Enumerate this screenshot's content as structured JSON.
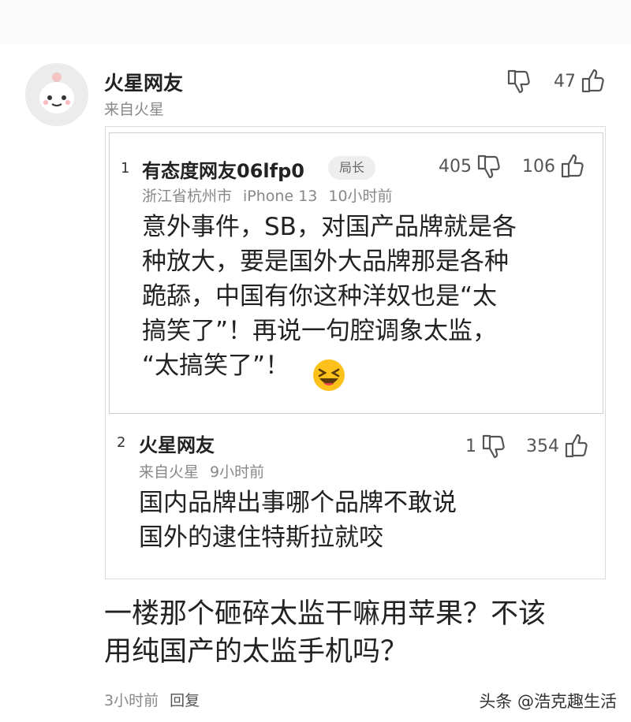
{
  "comment": {
    "author": "火星网友",
    "source": "来自火星",
    "dislike_icon": "thumbs-down-icon",
    "like_count": "47",
    "like_icon": "thumbs-up-icon",
    "text_lines": [
      "一楼那个砸碎太监干嘛用苹果？不该",
      "用纯国产的太监手机吗？"
    ],
    "time": "3小时前",
    "reply_label": "回复"
  },
  "replies": [
    {
      "index": "1",
      "author": "有态度网友06lfp0",
      "badge": "局长",
      "location": "浙江省杭州市",
      "device": "iPhone 13",
      "time": "10小时前",
      "dislike_count": "405",
      "like_count": "106",
      "text_lines": [
        "意外事件，SB，对国产品牌就是各",
        "种放大，要是国外大品牌那是各种",
        "跪舔，中国有你这种洋奴也是“太",
        "搞笑了”！再说一句腔调象太监，",
        "“太搞笑了”！"
      ],
      "emoji": "laughing-face-emoji"
    },
    {
      "index": "2",
      "author": "火星网友",
      "source": "来自火星",
      "time": "9小时前",
      "dislike_count": "1",
      "like_count": "354",
      "text_lines": [
        "国内品牌出事哪个品牌不敢说",
        "国外的逮住特斯拉就咬"
      ]
    }
  ],
  "watermark": "头条 @浩克趣生活"
}
